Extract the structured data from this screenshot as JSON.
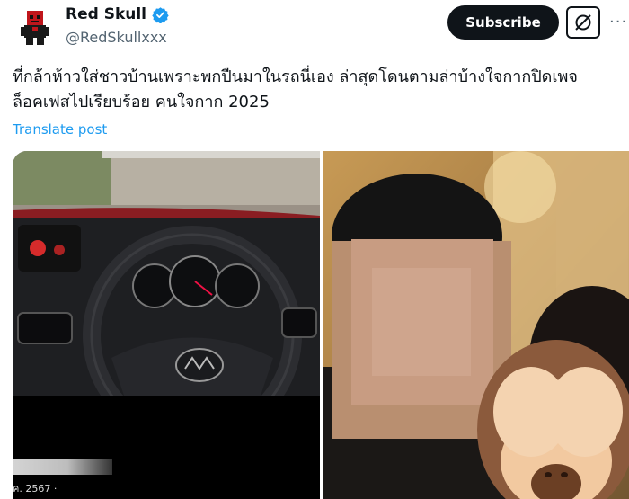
{
  "author": {
    "display_name": "Red Skull",
    "handle": "@RedSkullxxx",
    "verified": true,
    "verified_color": "#1d9bf0"
  },
  "actions": {
    "subscribe_label": "Subscribe",
    "more_label": "···",
    "grok_icon": "slash-circle-icon"
  },
  "post": {
    "text_line1": "ที่กล้าห้าวใส่ชาวบ้านเพราะพกปืนมาในรถนี่เอง ล่าสุดโดนตามล่าบ้างใจกากปิดเพจ",
    "text_line2": "ล็อคเฟสไปเรียบร้อย คนใจกาก 2025",
    "translate_label": "Translate post"
  },
  "media": {
    "left_caption": "ค. 2567 ·",
    "left_image": "car-dashboard-photo",
    "right_image": "blurred-man-photo",
    "sticker": "see-no-evil-monkey-icon"
  },
  "colors": {
    "accent": "#1d9bf0",
    "button_bg": "#0f1419"
  }
}
